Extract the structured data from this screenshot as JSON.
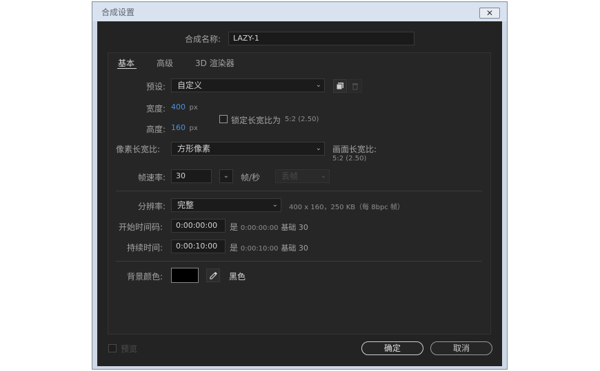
{
  "window": {
    "title": "合成设置",
    "close_glyph": "✕"
  },
  "comp_name": {
    "label": "合成名称:",
    "value": "LAZY-1"
  },
  "tabs": [
    {
      "label": "基本"
    },
    {
      "label": "高级"
    },
    {
      "label": "3D 渲染器"
    }
  ],
  "preset": {
    "label": "预设:",
    "value": "自定义"
  },
  "width": {
    "label": "宽度:",
    "value": "400",
    "unit": "px"
  },
  "height": {
    "label": "高度:",
    "value": "160",
    "unit": "px"
  },
  "lock_aspect": {
    "label": "锁定长宽比为",
    "ratio": "5:2 (2.50)",
    "checked": false
  },
  "pixel_aspect": {
    "label": "像素长宽比:",
    "value": "方形像素"
  },
  "frame_aspect": {
    "label": "画面长宽比:",
    "value": "5:2 (2.50)"
  },
  "frame_rate": {
    "label": "帧速率:",
    "value": "30",
    "unit": "帧/秒",
    "drop_frame": "丢帧"
  },
  "resolution": {
    "label": "分辨率:",
    "value": "完整",
    "info": "400 x 160，250 KB（每 8bpc 帧）"
  },
  "start_timecode": {
    "label": "开始时间码:",
    "value": "0:00:00:00",
    "info_prefix": "是",
    "info_time": "0:00:00:00",
    "info_base": "基础 30"
  },
  "duration": {
    "label": "持续时间:",
    "value": "0:00:10:00",
    "info_prefix": "是",
    "info_time": "0:00:10:00",
    "info_base": "基础 30"
  },
  "background": {
    "label": "背景颜色:",
    "color": "#000000",
    "name": "黑色"
  },
  "preview": {
    "label": "预览",
    "checked": false
  },
  "buttons": {
    "ok": "确定",
    "cancel": "取消"
  },
  "icons": [
    "close-icon",
    "chevron-down-icon",
    "new-preset-icon",
    "delete-preset-icon",
    "eyedropper-icon"
  ],
  "colors": {
    "accent_value": "#4f8edc",
    "dialog_bg": "#232323"
  }
}
